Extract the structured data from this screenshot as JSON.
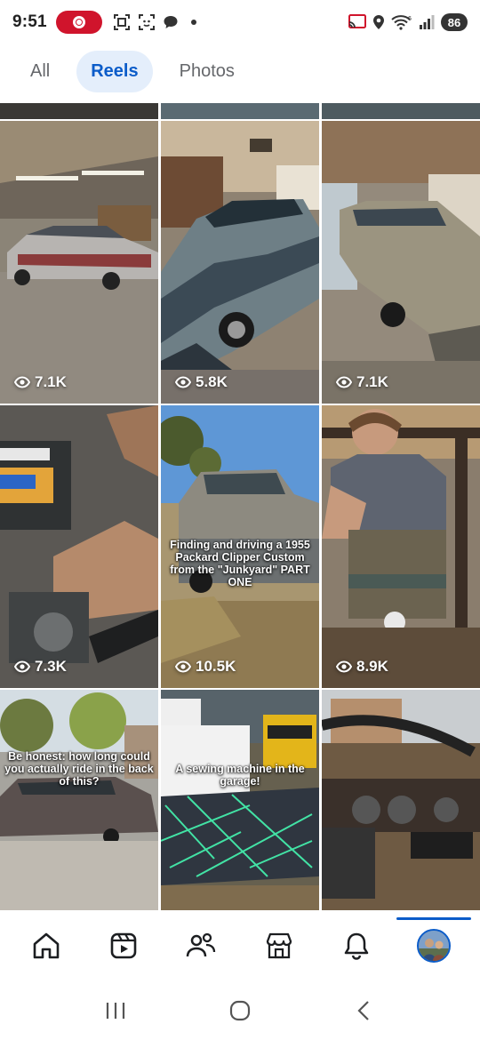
{
  "status_bar": {
    "time": "9:51",
    "battery": "86",
    "icons": [
      "screen-record-icon",
      "scan-icon",
      "face-scan-icon",
      "chat-icon",
      "cast-icon",
      "location-icon",
      "wifi-icon",
      "signal-icon"
    ]
  },
  "tabs": [
    {
      "label": "All",
      "active": false
    },
    {
      "label": "Reels",
      "active": true
    },
    {
      "label": "Photos",
      "active": false
    }
  ],
  "reels": [
    {
      "views": "7.1K",
      "caption": ""
    },
    {
      "views": "5.8K",
      "caption": ""
    },
    {
      "views": "7.1K",
      "caption": ""
    },
    {
      "views": "7.3K",
      "caption": ""
    },
    {
      "views": "10.5K",
      "caption": "Finding and driving a 1955 Packard Clipper Custom from the \"Junkyard\" PART ONE"
    },
    {
      "views": "8.9K",
      "caption": ""
    },
    {
      "views": "",
      "caption": "Be honest: how long could you actually ride in the back of this?"
    },
    {
      "views": "",
      "caption": "A sewing machine in the garage!"
    },
    {
      "views": "",
      "caption": ""
    }
  ],
  "bottom_nav": [
    {
      "name": "home-icon",
      "active": false
    },
    {
      "name": "video-icon",
      "active": false
    },
    {
      "name": "friends-icon",
      "active": false
    },
    {
      "name": "marketplace-icon",
      "active": false
    },
    {
      "name": "notifications-icon",
      "active": false
    },
    {
      "name": "profile-avatar",
      "active": true
    }
  ],
  "colors": {
    "accent": "#0b5cc9",
    "tab_active_bg": "#e4eefb",
    "recording": "#d0142c"
  }
}
